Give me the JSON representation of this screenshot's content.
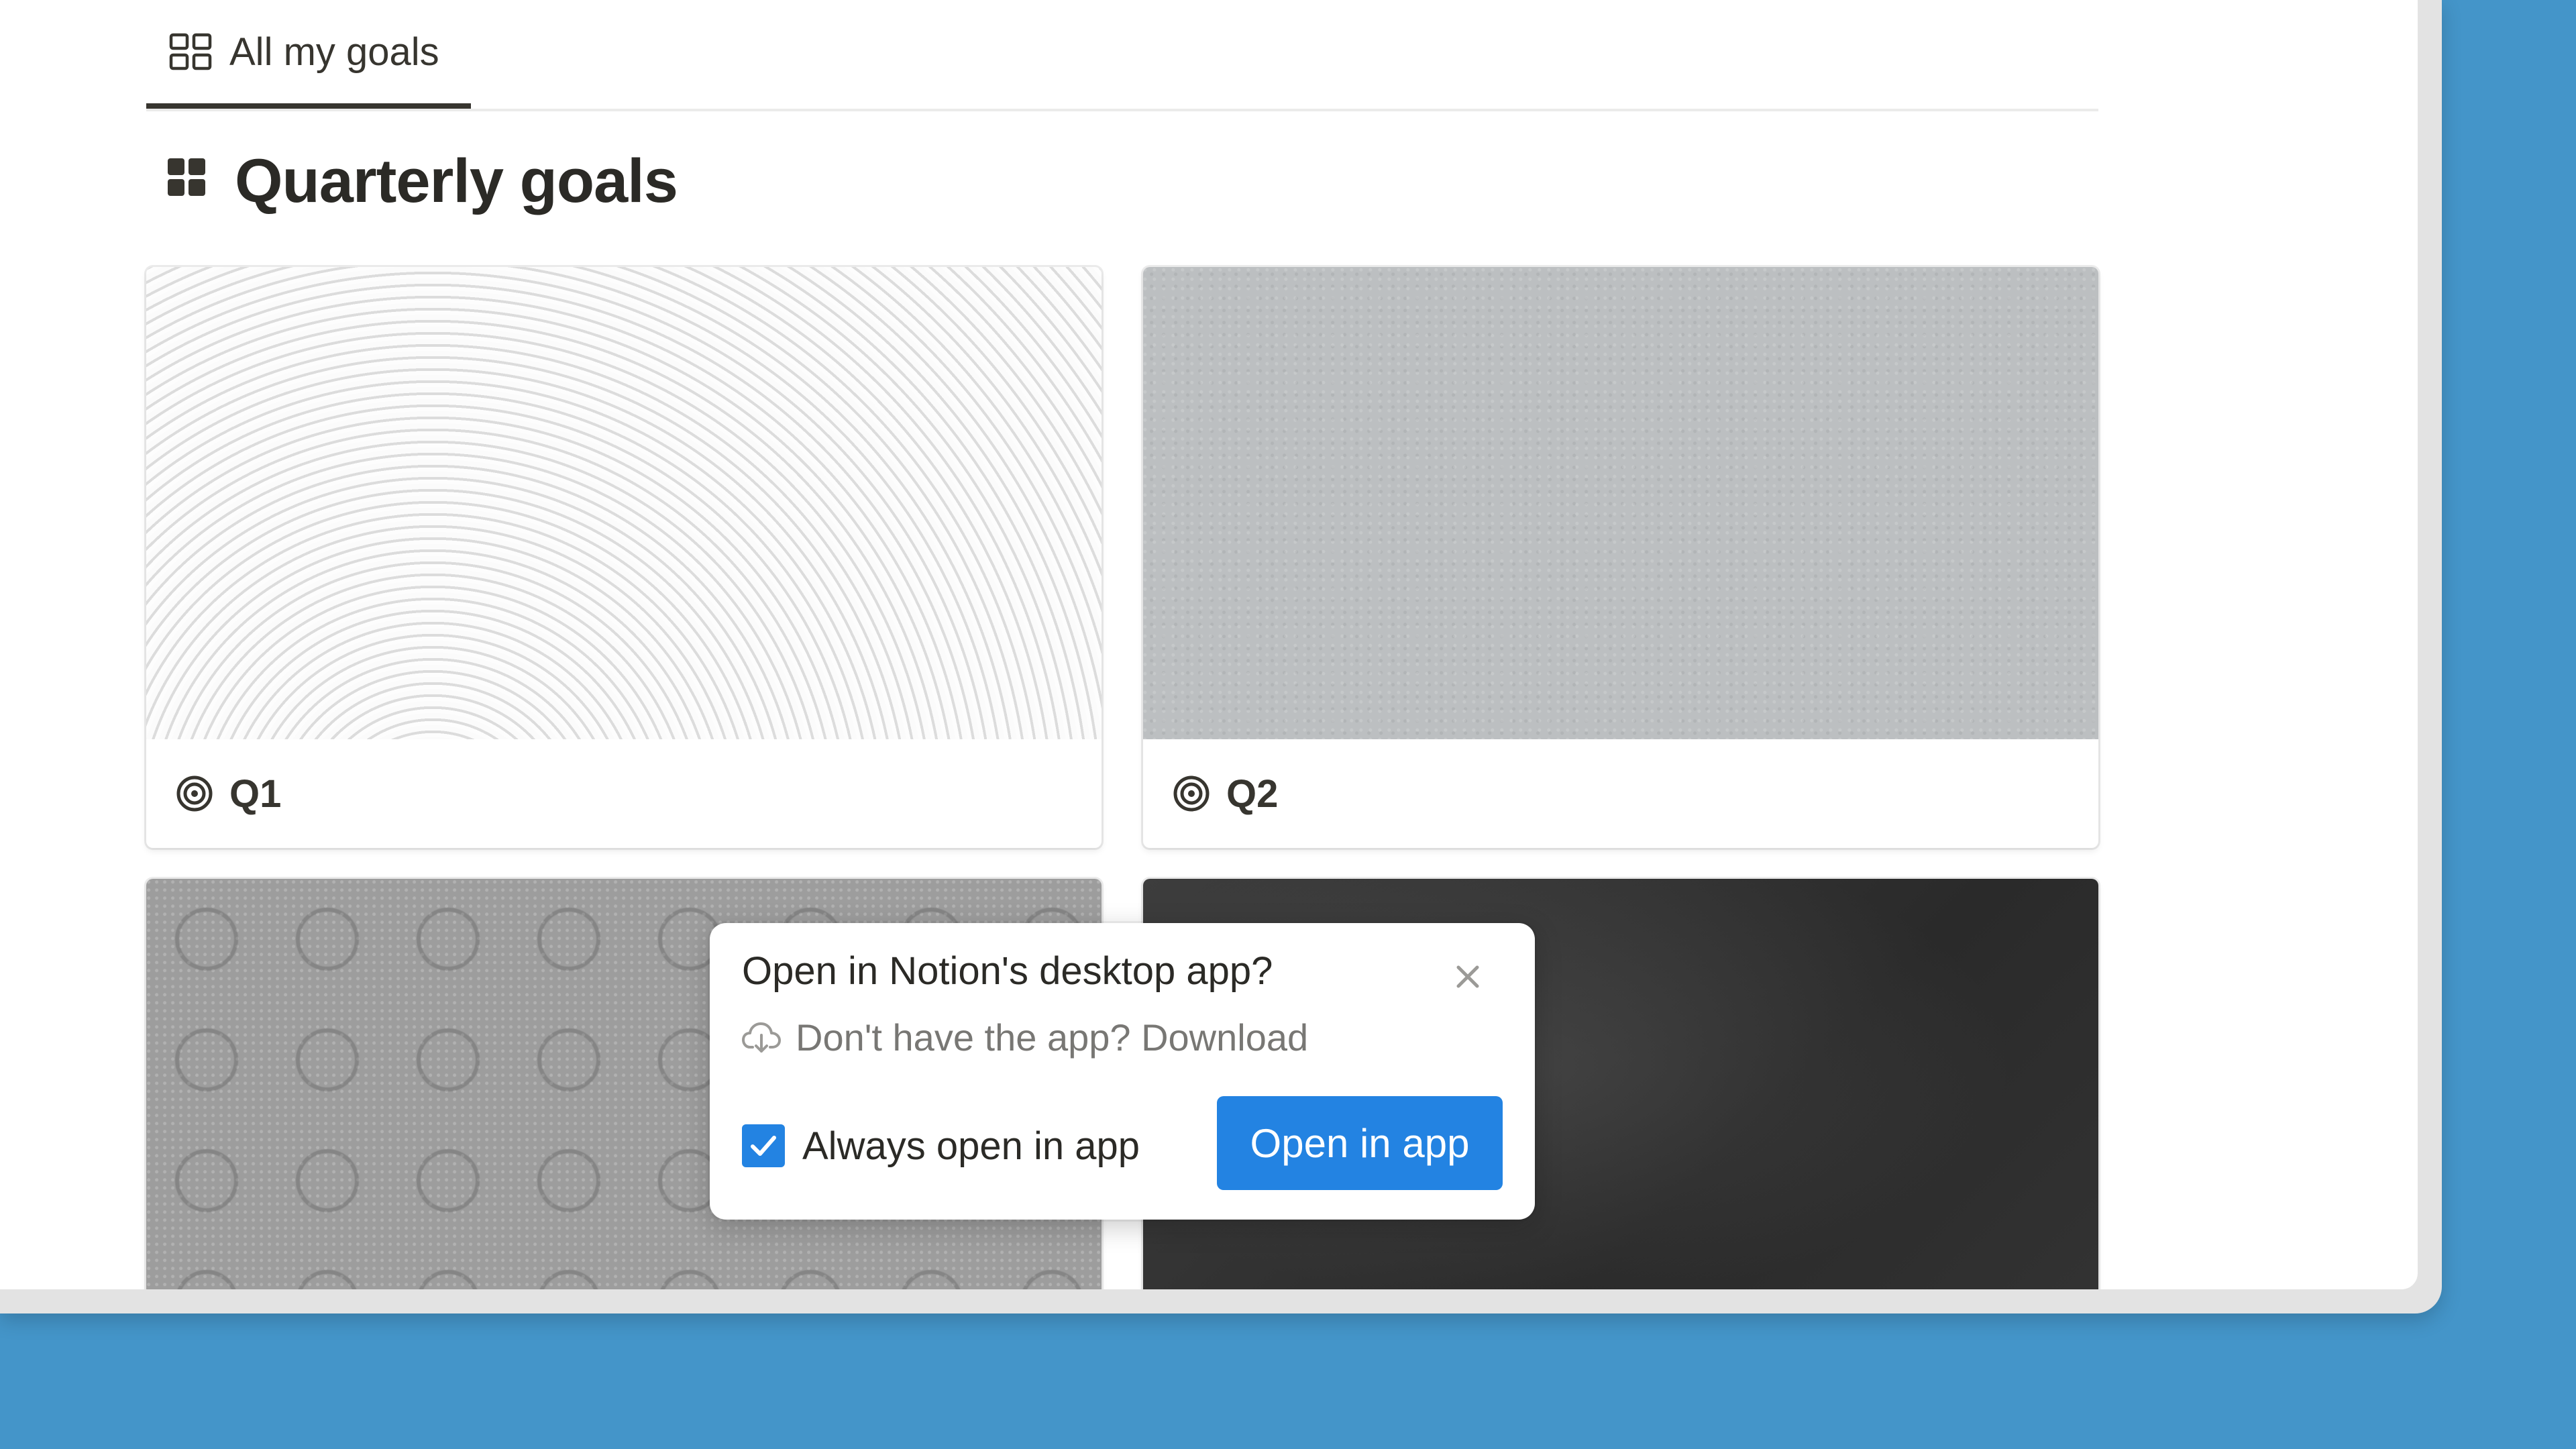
{
  "tabs": [
    {
      "label": "All my goals",
      "icon": "gallery-grid-icon",
      "active": true
    }
  ],
  "page": {
    "title": "Quarterly goals",
    "title_icon": "gallery-view-icon"
  },
  "cards": [
    {
      "label": "Q1",
      "icon": "target-icon",
      "cover": "white-plaster-texture"
    },
    {
      "label": "Q2",
      "icon": "target-icon",
      "cover": "gray-concrete-texture"
    },
    {
      "label": "",
      "icon": "",
      "cover": "gray-damask-texture"
    },
    {
      "label": "",
      "icon": "",
      "cover": "chalkboard-texture"
    }
  ],
  "popup": {
    "title": "Open in Notion's desktop app?",
    "download_text": "Don't have the app? Download",
    "download_icon": "cloud-download-icon",
    "checkbox_label": "Always open in app",
    "checkbox_checked": true,
    "open_button": "Open in app",
    "close_icon": "close-icon"
  },
  "colors": {
    "desktop_background": "#4495c9",
    "accent_blue": "#2383e2",
    "text_primary": "#37352f",
    "text_secondary": "#787774"
  }
}
